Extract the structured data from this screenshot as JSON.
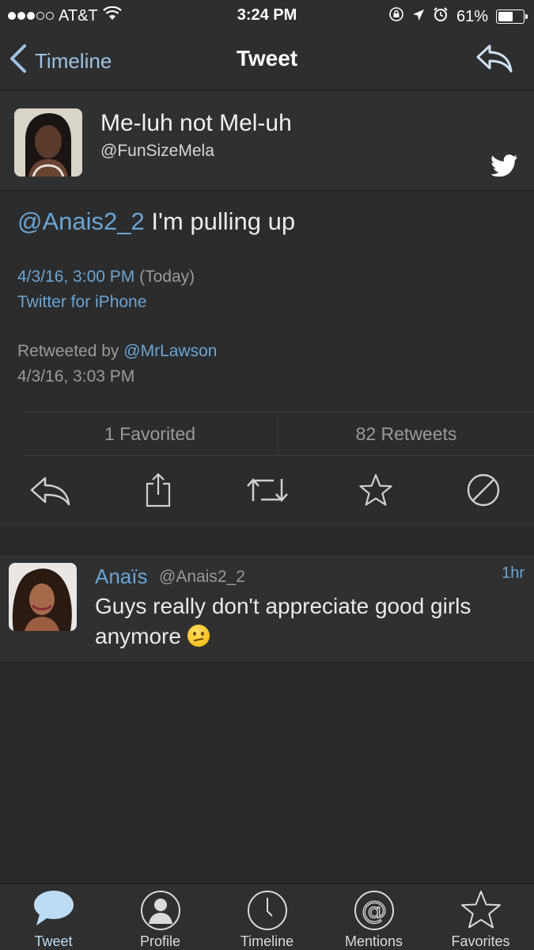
{
  "status_bar": {
    "carrier": "AT&T",
    "time": "3:24 PM",
    "battery": "61%",
    "battery_level": 0.61
  },
  "nav": {
    "back_label": "Timeline",
    "title": "Tweet",
    "reply_icon": "reply-icon"
  },
  "tweet": {
    "author_name": "Me-luh not Mel-uh",
    "author_handle": "@FunSizeMela",
    "mention": "@Anais2_2",
    "text": "I'm pulling up",
    "date": "4/3/16, 3:00 PM",
    "relative": "(Today)",
    "source": "Twitter for iPhone",
    "retweeted_by_label": "Retweeted by",
    "retweeted_by": "@MrLawson",
    "retweet_time": "4/3/16, 3:03 PM",
    "favorited": "1 Favorited",
    "retweets": "82 Retweets"
  },
  "actions": [
    "reply-icon",
    "share-icon",
    "retweet-icon",
    "favorite-star-icon",
    "block-icon"
  ],
  "reply": {
    "name": "Anaïs",
    "handle": "@Anais2_2",
    "time": "1hr",
    "text": "Guys really don't appreciate good girls anymore"
  },
  "tabs": [
    {
      "label": "Tweet",
      "icon": "speech-bubble-icon",
      "active": true
    },
    {
      "label": "Profile",
      "icon": "profile-icon",
      "active": false
    },
    {
      "label": "Timeline",
      "icon": "clock-icon",
      "active": false
    },
    {
      "label": "Mentions",
      "icon": "at-icon",
      "active": false
    },
    {
      "label": "Favorites",
      "icon": "star-icon",
      "active": false
    }
  ],
  "colors": {
    "link": "#6aa5d6",
    "background": "#282828",
    "tab_active": "#bcdcf6"
  }
}
